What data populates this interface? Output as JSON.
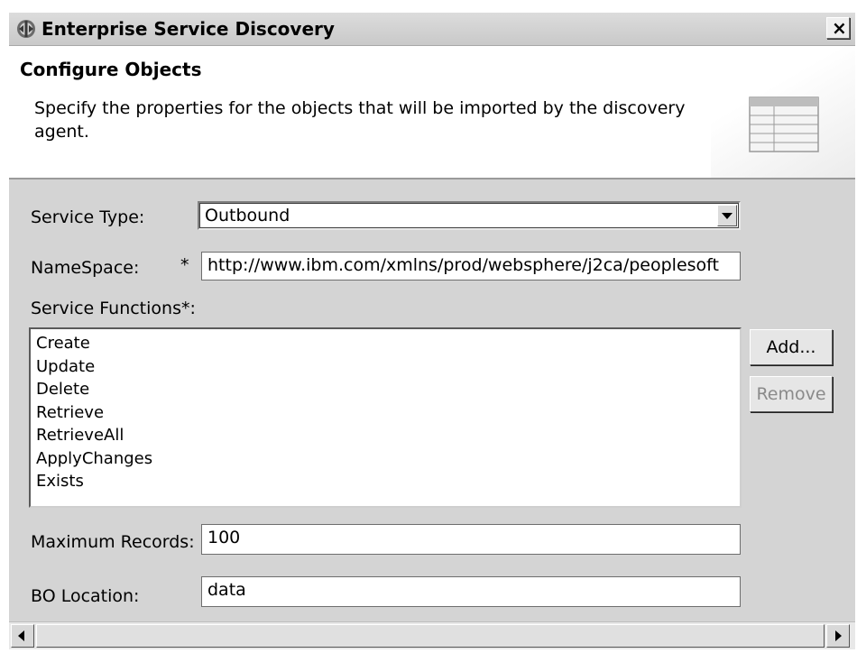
{
  "window": {
    "title": "Enterprise Service Discovery",
    "close_label": "×",
    "app_icon": "adapter-icon"
  },
  "header": {
    "title": "Configure Objects",
    "description": "Specify the properties for the objects that will be imported by the discovery agent.",
    "graphic_icon": "table-icon"
  },
  "form": {
    "service_type": {
      "label": "Service Type:",
      "value": "Outbound"
    },
    "namespace": {
      "label": "NameSpace:",
      "required_marker": "*",
      "value": "http://www.ibm.com/xmlns/prod/websphere/j2ca/peoplesoft"
    },
    "service_functions": {
      "label": "Service Functions*:",
      "items": [
        "Create",
        "Update",
        "Delete",
        "Retrieve",
        "RetrieveAll",
        "ApplyChanges",
        "Exists"
      ],
      "add_label": "Add...",
      "remove_label": "Remove"
    },
    "max_records": {
      "label": "Maximum Records:",
      "value": "100"
    },
    "bo_location": {
      "label": "BO Location:",
      "value": "data"
    }
  },
  "colors": {
    "content_background": "#d4d4d4",
    "title_bar": "#d0d0d0",
    "disabled_text": "#8a8a8a"
  }
}
